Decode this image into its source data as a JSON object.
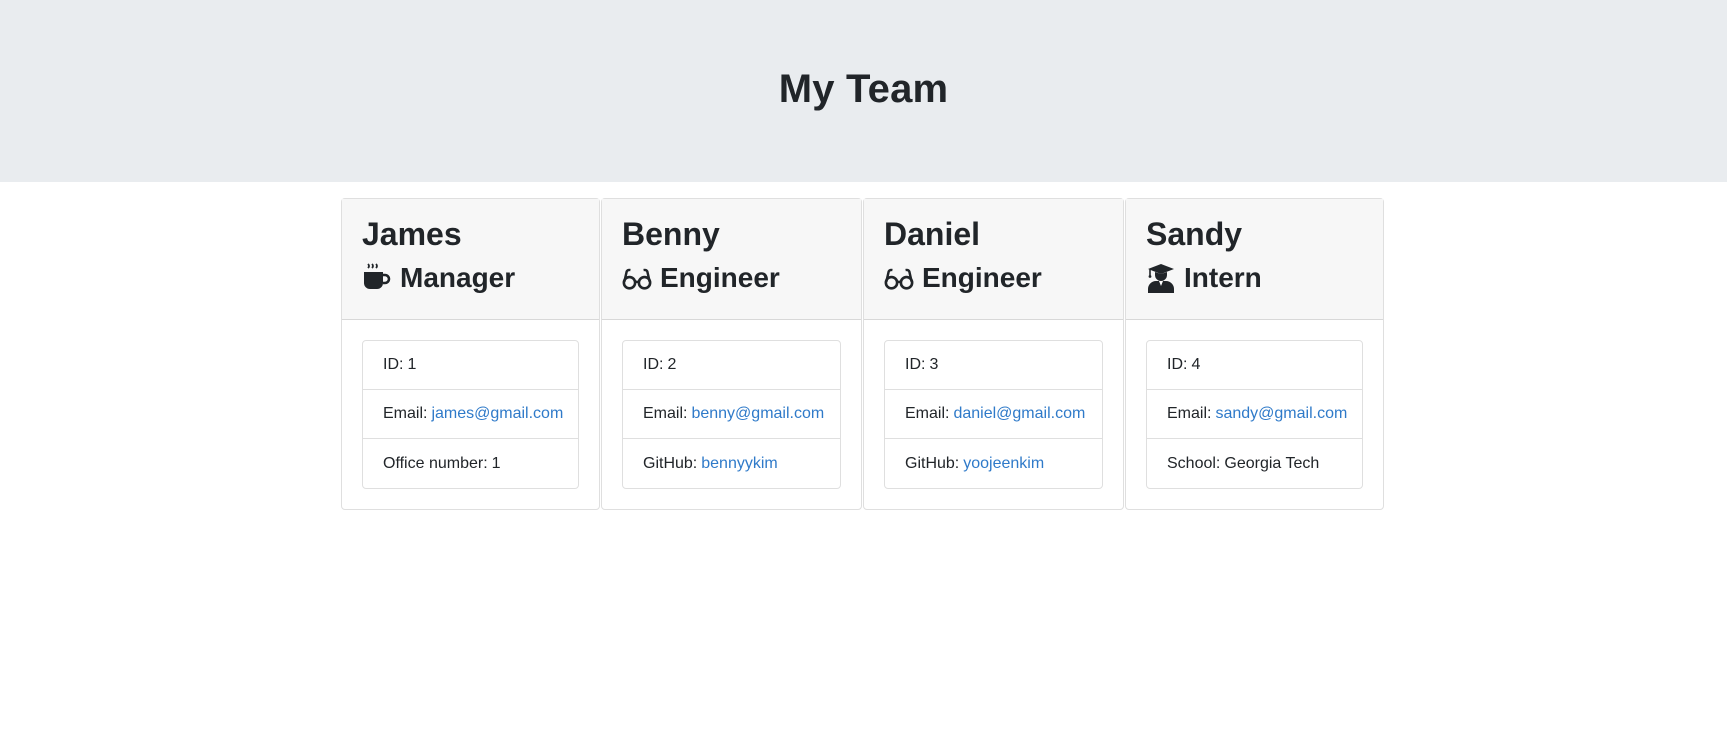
{
  "page": {
    "title": "My Team"
  },
  "team": [
    {
      "name": "James",
      "role": "Manager",
      "icon": "coffee-mug-icon",
      "id_label": "ID:",
      "id": "1",
      "email_label": "Email:",
      "email": "james@gmail.com",
      "extra_label": "Office number:",
      "extra": "1"
    },
    {
      "name": "Benny",
      "role": "Engineer",
      "icon": "glasses-icon",
      "id_label": "ID:",
      "id": "2",
      "email_label": "Email:",
      "email": "benny@gmail.com",
      "extra_label": "GitHub:",
      "extra": "bennyykim"
    },
    {
      "name": "Daniel",
      "role": "Engineer",
      "icon": "glasses-icon",
      "id_label": "ID:",
      "id": "3",
      "email_label": "Email:",
      "email": "daniel@gmail.com",
      "extra_label": "GitHub:",
      "extra": "yoojeenkim"
    },
    {
      "name": "Sandy",
      "role": "Intern",
      "icon": "graduate-icon",
      "id_label": "ID:",
      "id": "4",
      "email_label": "Email:",
      "email": "sandy@gmail.com",
      "extra_label": "School:",
      "extra": "Georgia Tech"
    }
  ],
  "colors": {
    "header_bg": "#e9ecef",
    "card_header_bg": "#f7f7f7",
    "link": "#2f7ac9"
  }
}
